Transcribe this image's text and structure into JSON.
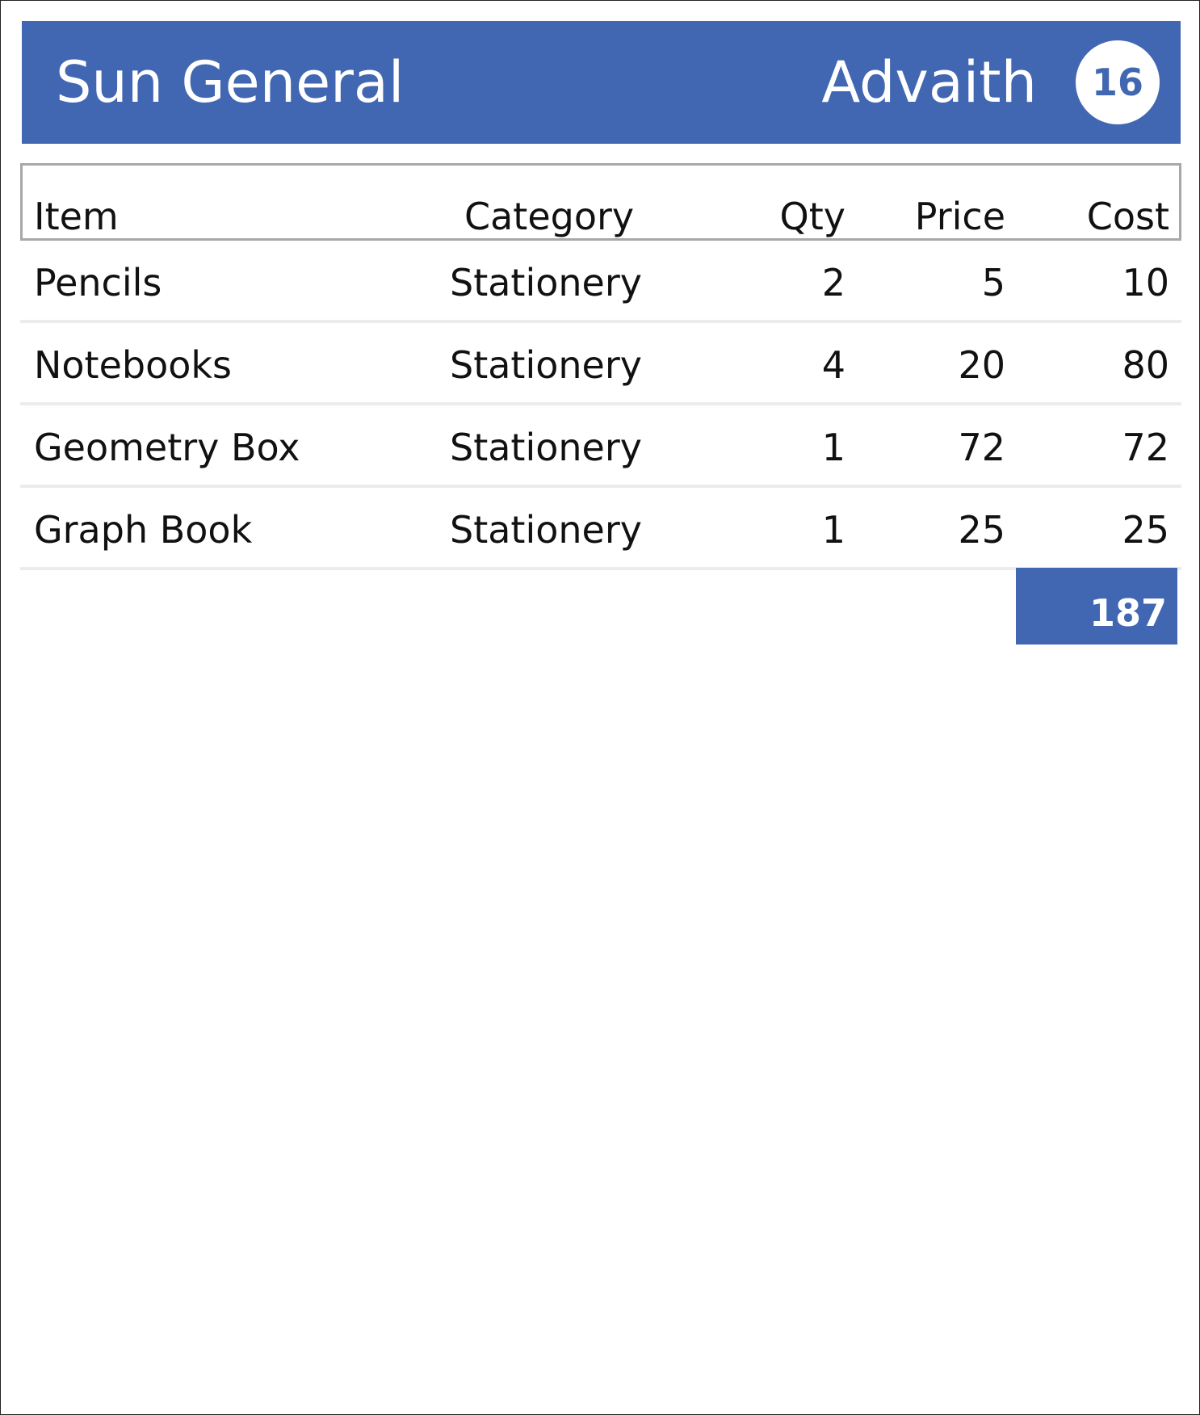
{
  "header": {
    "store_name": "Sun General",
    "customer_name": "Advaith",
    "count": "16"
  },
  "table": {
    "columns": [
      "Item",
      "Category",
      "Qty",
      "Price",
      "Cost"
    ],
    "rows": [
      {
        "item": "Pencils",
        "category": "Stationery",
        "qty": "2",
        "price": "5",
        "cost": "10"
      },
      {
        "item": "Notebooks",
        "category": "Stationery",
        "qty": "4",
        "price": "20",
        "cost": "80"
      },
      {
        "item": "Geometry Box",
        "category": "Stationery",
        "qty": "1",
        "price": "72",
        "cost": "72"
      },
      {
        "item": "Graph Book",
        "category": "Stationery",
        "qty": "1",
        "price": "25",
        "cost": "25"
      }
    ],
    "total": "187"
  },
  "colors": {
    "accent": "#4267b2",
    "divider": "#ececec",
    "header_border": "#a8a8a8"
  }
}
